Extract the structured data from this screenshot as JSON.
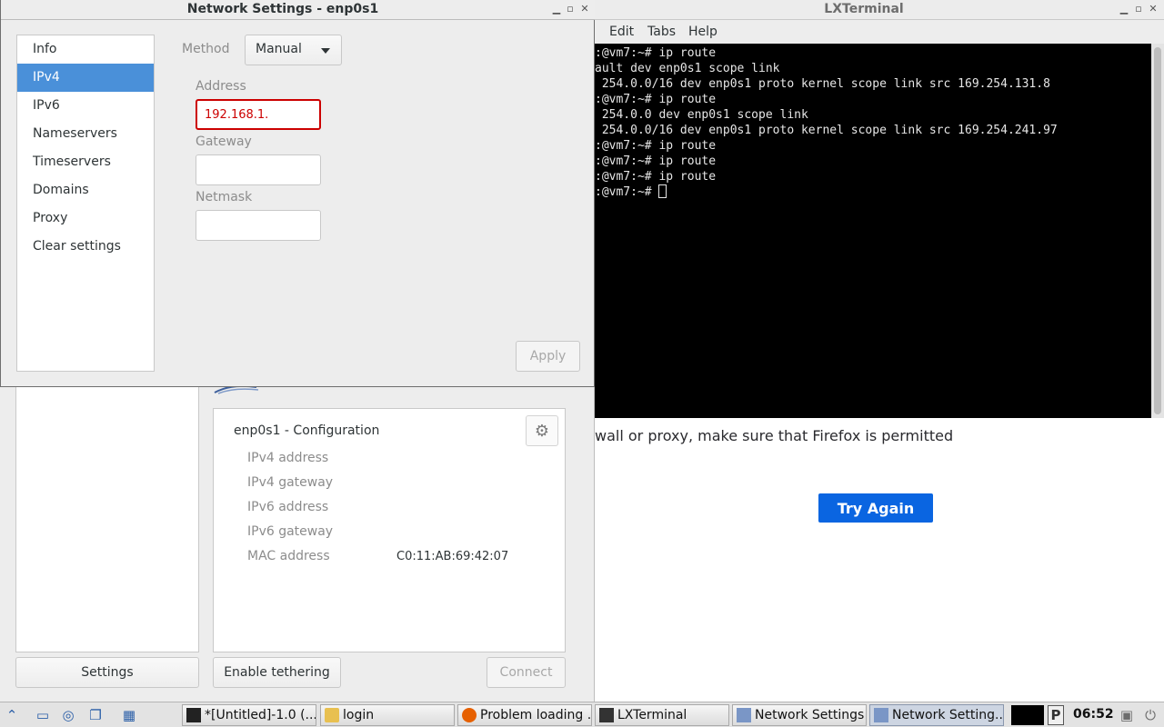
{
  "dialog": {
    "title": "Network Settings - enp0s1",
    "sidebar": [
      {
        "label": "Info",
        "active": false
      },
      {
        "label": "IPv4",
        "active": true
      },
      {
        "label": "IPv6",
        "active": false
      },
      {
        "label": "Nameservers",
        "active": false
      },
      {
        "label": "Timeservers",
        "active": false
      },
      {
        "label": "Domains",
        "active": false
      },
      {
        "label": "Proxy",
        "active": false
      },
      {
        "label": "Clear settings",
        "active": false
      }
    ],
    "method_label": "Method",
    "method_value": "Manual",
    "address_label": "Address",
    "address_value": "192.168.1.",
    "gateway_label": "Gateway",
    "gateway_value": "",
    "netmask_label": "Netmask",
    "netmask_value": "",
    "apply_label": "Apply"
  },
  "netmain": {
    "config_title": "enp0s1 - Configuration",
    "rows": [
      {
        "label": "IPv4 address",
        "value": ""
      },
      {
        "label": "IPv4 gateway",
        "value": ""
      },
      {
        "label": "IPv6 address",
        "value": ""
      },
      {
        "label": "IPv6 gateway",
        "value": ""
      },
      {
        "label": "MAC address",
        "value": "C0:11:AB:69:42:07"
      }
    ],
    "settings_label": "Settings",
    "tether_label": "Enable tethering",
    "connect_label": "Connect"
  },
  "lxterminal": {
    "title": "LXTerminal",
    "menu": [
      "Edit",
      "Tabs",
      "Help"
    ],
    "lines": [
      ":@vm7:~# ip route",
      "ault dev enp0s1 scope link",
      " 254.0.0/16 dev enp0s1 proto kernel scope link src 169.254.131.8",
      ":@vm7:~# ip route",
      " 254.0.0 dev enp0s1 scope link",
      " 254.0.0/16 dev enp0s1 proto kernel scope link src 169.254.241.97",
      ":@vm7:~# ip route",
      ":@vm7:~# ip route",
      ":@vm7:~# ip route",
      ":@vm7:~# "
    ]
  },
  "firefox": {
    "message": "wall or proxy, make sure that Firefox is permitted",
    "try_again": "Try Again"
  },
  "taskbar": {
    "tasks": [
      {
        "label": "*[Untitled]-1.0 (...",
        "active": false
      },
      {
        "label": "login",
        "active": false
      },
      {
        "label": "Problem loading ...",
        "active": false
      },
      {
        "label": "LXTerminal",
        "active": false
      },
      {
        "label": "Network Settings",
        "active": false
      },
      {
        "label": "Network Setting...",
        "active": true
      }
    ],
    "clock": "06:52"
  }
}
